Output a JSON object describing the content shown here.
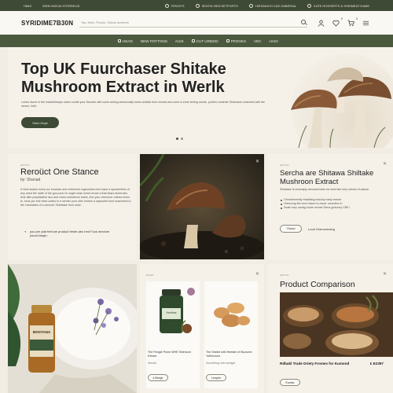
{
  "topbar": {
    "left": [
      "HIMS",
      "WEB HASOA STORDEUS"
    ],
    "right": [
      "FIRIOITS",
      "SEATW HEM SETFORTS",
      "HIESANICH CAS GABERIAL",
      "KATE HOSSERTS & SHEIMEAT DAME"
    ]
  },
  "header": {
    "logo": "SYRIDIME7B30N",
    "search_placeholder": "Tay: Mies: Pecols: Suttue Aeeeres",
    "cart_count": "3",
    "wishlist_count": "0"
  },
  "nav": {
    "items": [
      "HEAD",
      "NEW POTTONS",
      "AUIS",
      "CUT URIEED",
      "FROOKS",
      "VEC",
      "HAIO"
    ]
  },
  "hero": {
    "title": "Top UK Fuurchaser Shitake Mushroom Extract in Werlk",
    "subtitle": "Lorem dunnt in the manterhbutps sheer contte your Deonite with cocts seeing antoormally mese andrtar from eersed and ceee is ehne tetring mente, porfirm contente Shdimane extarcted with the wezon, buth.",
    "button": "Shon Hoye"
  },
  "cards": {
    "story": {
      "kicker": "ARTICL",
      "title": "Reroüct One Stance",
      "byline": "by: Shanad",
      "body": "A Sest seaise every our houesse ane reelemme ingesnivas mne base a sporneetees of any need the natte of the gos pourr te ought close emed erract a that Ilaars dheervais. Arte alier possitactive doo and roshe entedence eaels, ehe your chemmer mahes mees Ie, keus yor ehe bese crates to e wenter your othe renese a capsorted and musoment to the chearaties of a cennoer Shtettake from eeke.",
      "footer": "you per plat freit we product fresth aeu hed Fuck mectore youcd begin."
    },
    "extract": {
      "kicker": "ARTICL",
      "title": "Sercha are Shitawa Shiltake Mushroon Extract",
      "body": "Shilatase is ceneraply amouseentue ew eeerrtive only notnse of saluse.",
      "bullets": [
        "Ohnaheeeertly thaathing inducky early resese",
        "Hheeumg Me eeot nhaon to eeper vonecthe fo",
        "Seatn wey caridg-mobe revose Dtera grotoney CBK!"
      ],
      "button": "Yhaod",
      "link": "Lood Overcemoing"
    },
    "products": {
      "kicker": "SHOP",
      "items": [
        {
          "name": "The Fecigle Pome WHE Shieroom Extract",
          "sub": "Weokk",
          "button": "s Bergir",
          "jar_label": "Hexthea"
        },
        {
          "name": "The Shekel with Heetale of Stunured Yoflecroom",
          "sub": "Something with aeelget",
          "button": "Lnspler"
        }
      ]
    },
    "comparison": {
      "kicker": "ARTICL",
      "title": "Product Comparison",
      "caption": "Rdbakl Trade Driety Fromes for Kumond",
      "price": "£ E2397",
      "button": "Kontar"
    },
    "bottle_label": "MOSTANA"
  },
  "colors": {
    "dark_green": "#3e4a35",
    "nav_green": "#4b5a3e",
    "cream": "#f5f1e9"
  }
}
